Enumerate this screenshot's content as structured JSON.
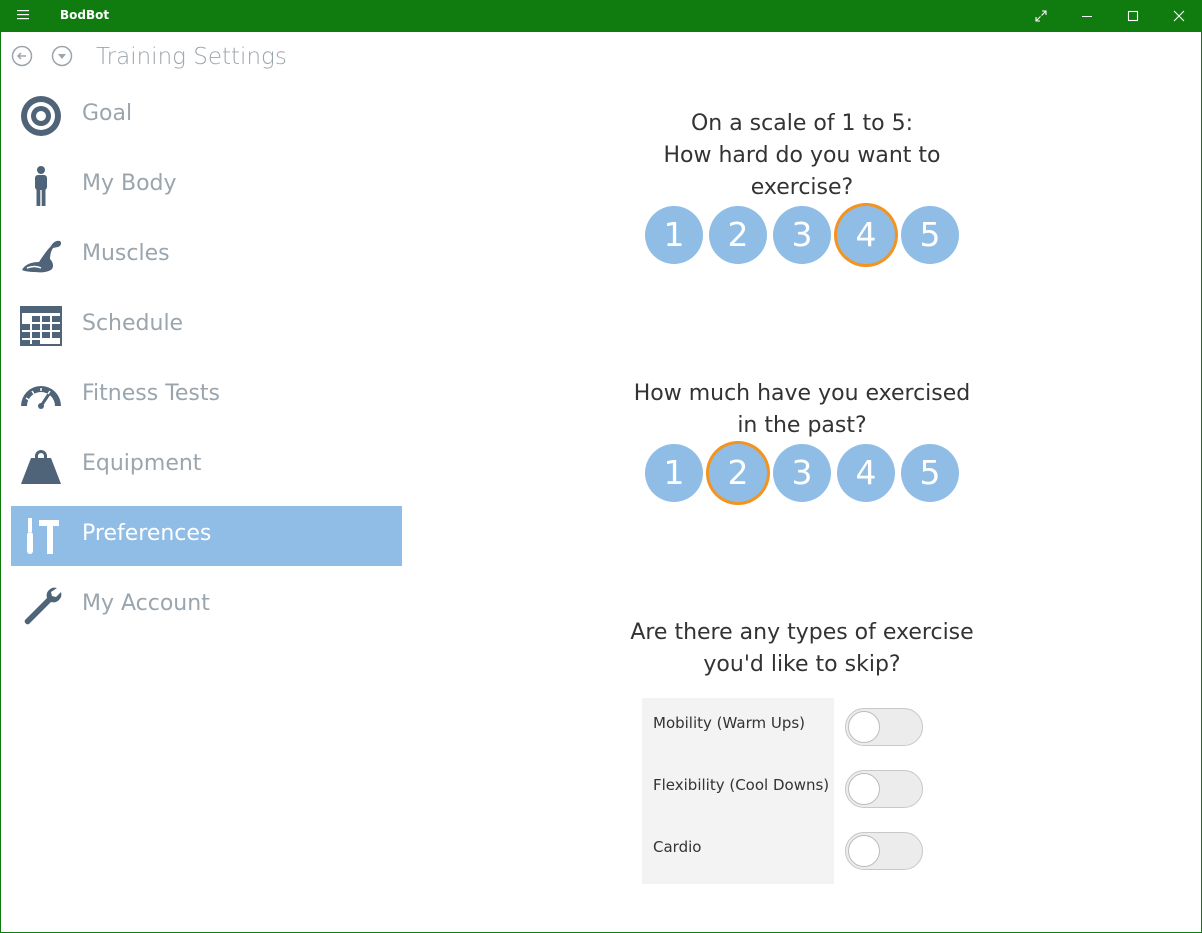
{
  "window": {
    "title": "BodBot"
  },
  "header": {
    "title": "Training Settings"
  },
  "sidebar": {
    "items": [
      {
        "label": "Goal",
        "icon": "target-icon"
      },
      {
        "label": "My Body",
        "icon": "person-icon"
      },
      {
        "label": "Muscles",
        "icon": "flexed-arm-icon"
      },
      {
        "label": "Schedule",
        "icon": "calendar-grid-icon"
      },
      {
        "label": "Fitness Tests",
        "icon": "gauge-icon"
      },
      {
        "label": "Equipment",
        "icon": "weight-icon"
      },
      {
        "label": "Preferences",
        "icon": "tools-icon",
        "active": true
      },
      {
        "label": "My Account",
        "icon": "wrench-icon"
      }
    ]
  },
  "intensity": {
    "question_line1": "On a scale of 1 to 5:",
    "question_line2": "How hard do you want to",
    "question_line3": "exercise?",
    "options": [
      "1",
      "2",
      "3",
      "4",
      "5"
    ],
    "selected": "4"
  },
  "history": {
    "question_line1": "How much have you exercised",
    "question_line2": "in the past?",
    "options": [
      "1",
      "2",
      "3",
      "4",
      "5"
    ],
    "selected": "2"
  },
  "skip": {
    "question_line1": "Are there any types of exercise",
    "question_line2": "you'd like to skip?",
    "items": [
      {
        "label": "Mobility (Warm Ups)",
        "on": false
      },
      {
        "label": "Flexibility (Cool Downs)",
        "on": false
      },
      {
        "label": "Cardio",
        "on": false
      }
    ]
  },
  "colors": {
    "titlebar": "#107c10",
    "accent_circle": "#8fbde6",
    "selected_ring": "#f39320",
    "nav_text": "#9aa5ad",
    "icon": "#4f6478"
  }
}
